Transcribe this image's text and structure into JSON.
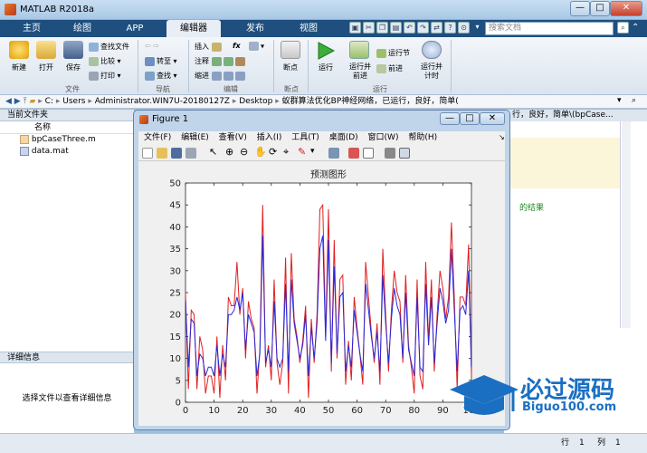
{
  "app": {
    "title": "MATLAB R2018a",
    "minimize": "—",
    "maximize": "□",
    "close": "✕"
  },
  "tabs": [
    "主页",
    "绘图",
    "APP",
    "编辑器",
    "发布",
    "视图"
  ],
  "search": {
    "placeholder": "搜索文档"
  },
  "ribbon": {
    "file": {
      "new": "新建",
      "open": "打开",
      "save": "保存",
      "find_files": "查找文件",
      "compare": "比较",
      "print": "打印",
      "label": "文件"
    },
    "nav": {
      "goto": "转至",
      "find": "查找",
      "label": "导航"
    },
    "edit": {
      "insert": "插入",
      "comment": "注释",
      "indent": "缩进",
      "fx": "fx",
      "label": "编辑"
    },
    "breakpoints": {
      "btn": "断点",
      "label": "断点"
    },
    "run": {
      "run": "运行",
      "run_advance": "运行并\n前进",
      "run_section": "运行节",
      "advance": "前进",
      "run_time": "运行并\n计时",
      "label": "运行"
    }
  },
  "address": {
    "parts": [
      "C:",
      "Users",
      "Administrator.WIN7U-20180127Z",
      "Desktop",
      "蚁群算法优化BP神经网络，已运行，良好，简单("
    ]
  },
  "current_folder": {
    "title": "当前文件夹",
    "col_name": "名称",
    "files": [
      {
        "name": "bpCaseThree.m",
        "type": "m"
      },
      {
        "name": "data.mat",
        "type": "mat"
      }
    ]
  },
  "details": {
    "title": "详细信息",
    "message": "选择文件以查看详细信息"
  },
  "editor": {
    "tab_text": "行，良好，简单\\(bpCase...",
    "snippet": "的结果"
  },
  "status": {
    "row_label": "行",
    "row": "1",
    "col_label": "列",
    "col": "1"
  },
  "figure": {
    "title": "Figure 1",
    "menu": [
      "文件(F)",
      "编辑(E)",
      "查看(V)",
      "插入(I)",
      "工具(T)",
      "桌面(D)",
      "窗口(W)",
      "帮助(H)"
    ]
  },
  "chart_data": {
    "type": "line",
    "title": "预测图形",
    "xlabel": "",
    "ylabel": "",
    "xlim": [
      0,
      100
    ],
    "ylim": [
      0,
      50
    ],
    "xticks": [
      0,
      10,
      20,
      30,
      40,
      50,
      60,
      70,
      80,
      90,
      100
    ],
    "yticks": [
      0,
      5,
      10,
      15,
      20,
      25,
      30,
      35,
      40,
      45,
      50
    ],
    "grid": false,
    "series": [
      {
        "color": "#e02020",
        "values": [
          25,
          3,
          21,
          20,
          3,
          15,
          12,
          2,
          6,
          6,
          2,
          15,
          1,
          13,
          5,
          24,
          22,
          22,
          32,
          20,
          26,
          10,
          23,
          19,
          17,
          2,
          12,
          45,
          8,
          13,
          5,
          28,
          9,
          4,
          9,
          33,
          2,
          34,
          19,
          15,
          9,
          14,
          22,
          1,
          19,
          9,
          20,
          44,
          45,
          15,
          44,
          7,
          37,
          10,
          28,
          29,
          4,
          14,
          5,
          24,
          17,
          11,
          4,
          32,
          24,
          16,
          9,
          18,
          4,
          35,
          20,
          7,
          21,
          30,
          25,
          23,
          9,
          29,
          13,
          8,
          2,
          28,
          6,
          3,
          32,
          14,
          28,
          7,
          20,
          30,
          26,
          19,
          24,
          41,
          24,
          3,
          24,
          24,
          22,
          36,
          6
        ]
      },
      {
        "color": "#2a2ad8",
        "values": [
          23,
          8,
          19,
          18,
          6,
          11,
          10,
          6,
          8,
          8,
          6,
          13,
          6,
          11,
          8,
          20,
          20,
          21,
          24,
          21,
          25,
          12,
          20,
          18,
          16,
          6,
          11,
          38,
          9,
          12,
          8,
          23,
          10,
          8,
          10,
          27,
          7,
          28,
          18,
          14,
          10,
          13,
          20,
          6,
          17,
          10,
          18,
          35,
          38,
          14,
          37,
          9,
          31,
          11,
          24,
          25,
          7,
          13,
          8,
          21,
          16,
          11,
          7,
          27,
          21,
          15,
          10,
          16,
          7,
          29,
          18,
          9,
          19,
          26,
          22,
          20,
          10,
          25,
          12,
          9,
          6,
          24,
          8,
          7,
          27,
          13,
          24,
          9,
          18,
          26,
          23,
          18,
          21,
          35,
          21,
          7,
          21,
          22,
          20,
          30,
          8
        ]
      }
    ]
  },
  "brand": {
    "cn": "必过源码",
    "url": "Biguo100.com"
  }
}
